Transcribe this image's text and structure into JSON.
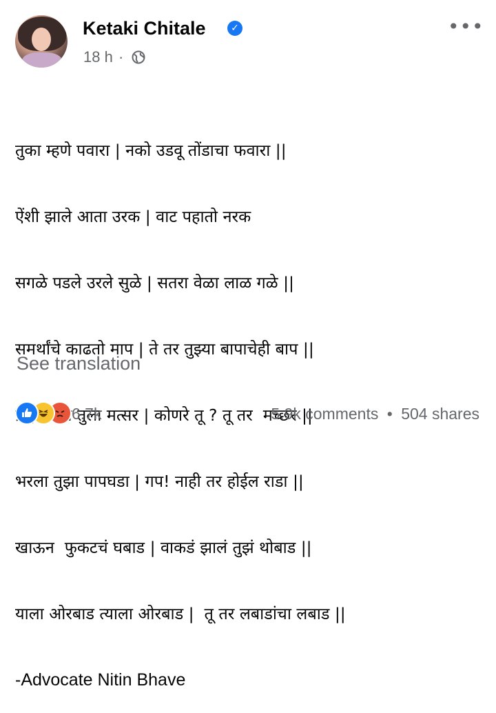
{
  "author": {
    "name": "Ketaki Chitale",
    "time": "18 h",
    "separator": "·"
  },
  "post_lines": [
    "तुका म्हणे पवारा | नको उडवू तोंडाचा फवारा ||",
    "ऐंशी झाले आता उरक | वाट पहातो नरक",
    "सगळे पडले उरले सुळे | सतरा वेळा लाळ गळे ||",
    "समर्थांचे काढतो माप | ते तर तुझ्या बापाचेही बाप ||",
    "ब्राह्मणांचा तुला मत्सर | कोणरे तू ? तू तर  मच्छर ||",
    "भरला तुझा पापघडा | गप! नाही तर होईल राडा ||",
    "खाऊन  फुकटचं घबाड | वाकडं झालं तुझं थोबाड ||",
    "याला ओरबाड त्याला ओरबाड |  तू तर लबाडांचा लबाड ||",
    "-Advocate Nitin Bhave"
  ],
  "see_translation": "See translation",
  "reactions": {
    "icons": [
      "like-icon",
      "haha-icon",
      "angry-icon"
    ],
    "count": "6.7k"
  },
  "engagement": {
    "comments": "5.9k comments",
    "separator": "•",
    "shares": "504 shares"
  },
  "colors": {
    "accent": "#1877f2",
    "secondary_text": "#65676b"
  }
}
